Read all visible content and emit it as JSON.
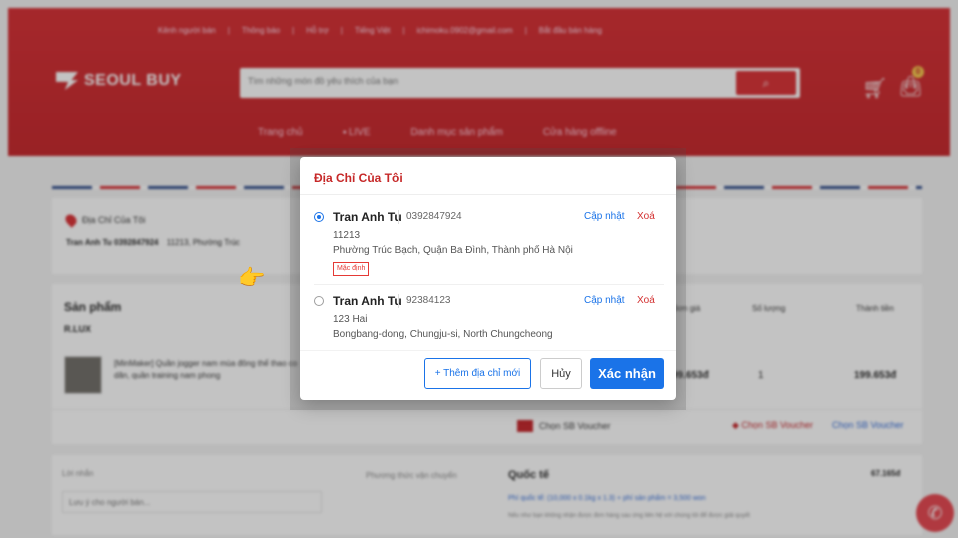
{
  "topbar": {
    "seller_channel": "Kênh người bán",
    "notifications": "Thông báo",
    "support": "Hỗ trợ",
    "language": "Tiếng Việt",
    "email": "ichimoku.0902@gmail.com",
    "start_selling": "Bắt đầu bán hàng"
  },
  "brand": {
    "name": "SEOUL BUY"
  },
  "search": {
    "placeholder": "Tìm những món đồ yêu thích của bạn"
  },
  "header_icons": {
    "cart": "cart-icon",
    "bag": "shopping-bag-icon",
    "bag_badge": "0"
  },
  "nav": {
    "home": "Trang chủ",
    "live": "LIVE",
    "categories": "Danh mục sản phẩm",
    "offline": "Cửa hàng offline"
  },
  "address_section": {
    "title": "Địa Chỉ Của Tôi",
    "name_phone": "Tran Anh Tu 0392847924",
    "address": "11213, Phường Trúc"
  },
  "products": {
    "heading": "Sản phẩm",
    "shop": "R.LUX",
    "col_price": "Đơn giá",
    "col_qty": "Số lượng",
    "col_total": "Thành tiền",
    "item_name": "[MinMaker] Quần jogger nam mùa đông thể thao co dãn, quần training nam phong",
    "item_price": "99.653đ",
    "item_qty": "1",
    "item_total": "199.653đ",
    "voucher_sb": "Chọn SB Voucher",
    "voucher_sb2": "Chọn SB Voucher",
    "voucher_shop": "Chọn SB Voucher"
  },
  "shipping": {
    "note_label": "Lời nhắn",
    "note_placeholder": "Lưu ý cho người bán...",
    "method_label": "Phương thức vận chuyển",
    "method_name": "Quốc tế",
    "fee": "67.165đ",
    "fee_detail": "Phí quốc tế: (10,000 x 0.1kg x 1.3) + phí sản phẩm = 3,500 won",
    "note": "Nếu như bạn không nhận được đơn hàng sau ứng liên hệ với chúng tôi để được giải quyết"
  },
  "modal": {
    "title": "Địa Chỉ Của Tôi",
    "addresses": [
      {
        "name": "Tran Anh Tu",
        "phone": "0392847924",
        "line1": "11213",
        "line2": "Phường Trúc Bạch, Quận Ba Đình, Thành phố Hà Nội",
        "badge": "Mặc định",
        "selected": true
      },
      {
        "name": "Tran Anh Tu",
        "phone": "92384123",
        "line1": "123 Hai",
        "line2": "Bongbang-dong, Chungju-si, North Chungcheong",
        "selected": false
      }
    ],
    "update_label": "Cập nhật",
    "delete_label": "Xoá",
    "add_button": "+ Thêm địa chỉ mới",
    "cancel_button": "Hủy",
    "confirm_button": "Xác nhận"
  },
  "colors": {
    "brand_red": "#c41f24",
    "accent_blue": "#1a73e8",
    "delete_red": "#d32f2f"
  }
}
